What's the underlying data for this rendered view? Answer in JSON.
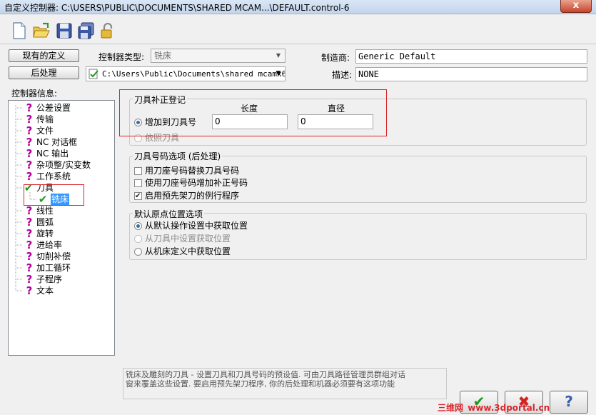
{
  "window": {
    "title": "自定义控制器: C:\\USERS\\PUBLIC\\DOCUMENTS\\SHARED MCAM...\\DEFAULT.control-6",
    "close_label": "x"
  },
  "toolbar": {
    "icons": [
      "new-file-icon",
      "open-folder-icon",
      "save-icon",
      "save-as-icon",
      "lock-icon"
    ]
  },
  "top": {
    "existing_defs_label": "现有的定义",
    "post_label": "后处理",
    "controller_type_label": "控制器类型:",
    "controller_type_value": "铣床",
    "post_path": "C:\\Users\\Public\\Documents\\shared mcamx6'",
    "manufacturer_label": "制造商:",
    "manufacturer_value": "Generic Default",
    "description_label": "描述:",
    "description_value": "NONE"
  },
  "tree": {
    "label": "控制器信息:",
    "items": [
      {
        "label": "公差设置",
        "icon": "question-icon"
      },
      {
        "label": "传输",
        "icon": "question-icon"
      },
      {
        "label": "文件",
        "icon": "question-icon"
      },
      {
        "label": "NC 对话框",
        "icon": "question-icon"
      },
      {
        "label": "NC 输出",
        "icon": "question-icon"
      },
      {
        "label": "杂项整/实变数",
        "icon": "question-icon"
      },
      {
        "label": "工作系统",
        "icon": "question-icon"
      },
      {
        "label": "刀具",
        "icon": "check-icon"
      },
      {
        "label": "铣床",
        "icon": "check-icon",
        "child": true,
        "selected": true
      },
      {
        "label": "线性",
        "icon": "question-icon"
      },
      {
        "label": "圆弧",
        "icon": "question-icon"
      },
      {
        "label": "旋转",
        "icon": "question-icon"
      },
      {
        "label": "进给率",
        "icon": "question-icon"
      },
      {
        "label": "切削补偿",
        "icon": "question-icon"
      },
      {
        "label": "加工循环",
        "icon": "question-icon"
      },
      {
        "label": "子程序",
        "icon": "question-icon"
      },
      {
        "label": "文本",
        "icon": "question-icon"
      }
    ]
  },
  "tool_comp": {
    "title": "刀具补正登记",
    "length_header": "长度",
    "diameter_header": "直径",
    "add_to_tool_label": "增加到刀具号",
    "length_value": "0",
    "diameter_value": "0",
    "follow_tool_label": "依照刀具"
  },
  "tool_number": {
    "title": "刀具号码选项 (后处理)",
    "options": [
      {
        "label": "用刀座号码替换刀具号码",
        "checked": false
      },
      {
        "label": "使用刀座号码增加补正号码",
        "checked": false
      },
      {
        "label": "启用预先架刀的例行程序",
        "checked": true
      }
    ]
  },
  "home": {
    "title": "默认原点位置选项",
    "options": [
      {
        "label": "从默认操作设置中获取位置",
        "selected": true,
        "disabled": false
      },
      {
        "label": "从刀具中设置获取位置",
        "selected": false,
        "disabled": true
      },
      {
        "label": "从机床定义中获取位置",
        "selected": false,
        "disabled": false
      }
    ]
  },
  "help_text": {
    "line1": "铣床及雕刻的刀具 - 设置刀具和刀具号码的预设值. 可由刀具路径管理员群组对话",
    "line2": "窗来覆盖这些设置. 要启用预先架刀程序, 你的后处理和机器必须要有这项功能"
  },
  "buttons": {
    "ok": "✔",
    "cancel": "✖",
    "help": "?"
  },
  "watermark": {
    "cn": "三维网",
    "url": "www.3dportal.cn"
  },
  "colors": {
    "highlight_red": "#d9262c",
    "check_green": "#1a9b1a",
    "question_magenta": "#b0009f"
  }
}
